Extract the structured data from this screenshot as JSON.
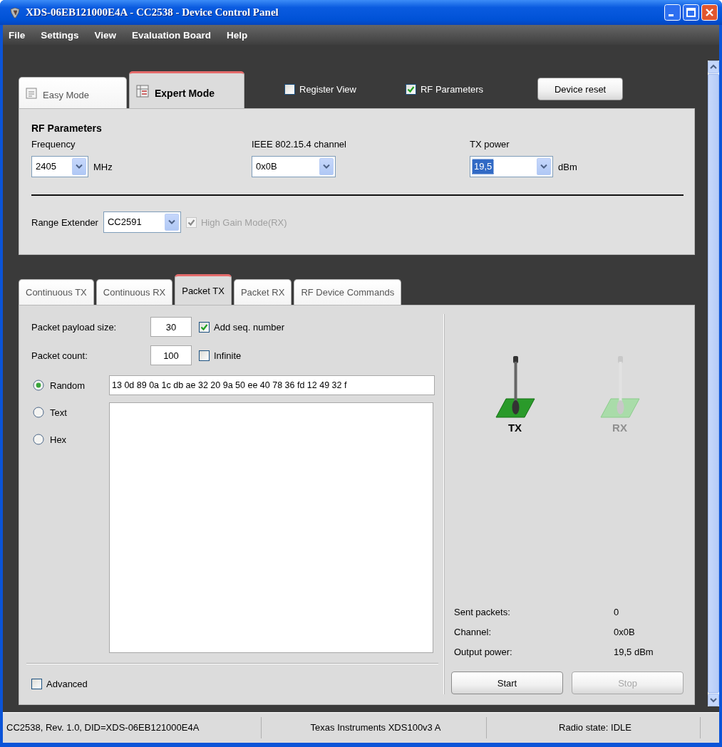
{
  "window": {
    "title": "XDS-06EB121000E4A - CC2538 - Device Control Panel"
  },
  "menu": [
    {
      "label": "File"
    },
    {
      "label": "Settings"
    },
    {
      "label": "View"
    },
    {
      "label": "Evaluation Board"
    },
    {
      "label": "Help"
    }
  ],
  "mode_tabs": [
    {
      "label": "Easy Mode",
      "selected": false
    },
    {
      "label": "Expert Mode",
      "selected": true
    }
  ],
  "options": [
    {
      "label": "Register View",
      "checked": false
    },
    {
      "label": "RF Parameters",
      "checked": true
    }
  ],
  "device_reset": "Device reset",
  "rf_parameters": {
    "title": "RF Parameters",
    "fields": [
      {
        "label": "Frequency",
        "value": "2405",
        "unit": "MHz",
        "focused": false
      },
      {
        "label": "IEEE 802.15.4 channel",
        "value": "0x0B",
        "focused": false
      },
      {
        "label": "TX power",
        "value": "19,5",
        "unit": "dBm",
        "focused": true
      }
    ],
    "range_extender": {
      "label": "Range Extender",
      "value": "CC2591"
    },
    "high_gain": {
      "label": "High Gain Mode(RX)",
      "checked": true,
      "disabled": true
    }
  },
  "function_tabs": [
    {
      "label": "Continuous TX",
      "selected": false
    },
    {
      "label": "Continuous RX",
      "selected": false
    },
    {
      "label": "Packet TX",
      "selected": true
    },
    {
      "label": "Packet RX",
      "selected": false
    },
    {
      "label": "RF Device Commands",
      "selected": false
    }
  ],
  "packet_tx": {
    "payload_size": {
      "label": "Packet payload size:",
      "value": "30"
    },
    "add_seq": {
      "label": "Add seq. number",
      "checked": true
    },
    "count": {
      "label": "Packet count:",
      "value": "100"
    },
    "infinite": {
      "label": "Infinite",
      "checked": false
    },
    "data_modes": [
      {
        "label": "Random",
        "selected": true
      },
      {
        "label": "Text",
        "selected": false
      },
      {
        "label": "Hex",
        "selected": false
      }
    ],
    "random_data": "13 0d 89 0a 1c db ae 32 20 9a 50 ee 40 78 36 fd 12 49 32 f",
    "advanced": {
      "label": "Advanced",
      "checked": false
    }
  },
  "indicators": [
    {
      "label": "TX",
      "active": true
    },
    {
      "label": "RX",
      "active": false
    }
  ],
  "stats": [
    {
      "label": "Sent packets:",
      "value": "0"
    },
    {
      "label": "Channel:",
      "value": "0x0B"
    },
    {
      "label": "Output power:",
      "value": "19,5 dBm"
    }
  ],
  "buttons": [
    {
      "label": "Start",
      "disabled": false
    },
    {
      "label": "Stop",
      "disabled": true
    }
  ],
  "status_bar": [
    "CC2538, Rev. 1.0, DID=XDS-06EB121000E4A",
    "Texas Instruments XDS100v3 A",
    "Radio state: IDLE"
  ]
}
